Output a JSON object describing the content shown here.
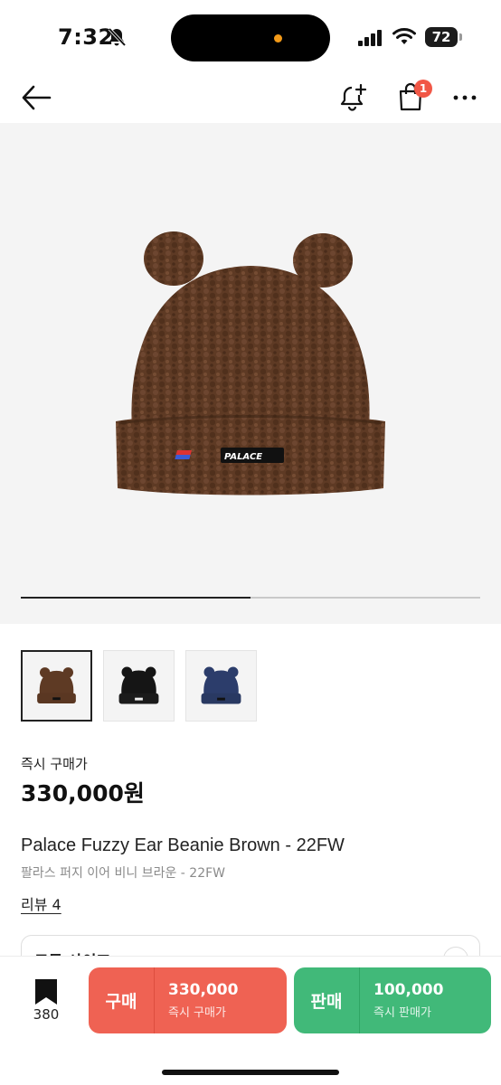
{
  "status_bar": {
    "time": "7:32",
    "battery": "72"
  },
  "nav": {
    "bag_badge": "1"
  },
  "gallery": {
    "brand_patch_text": "PALACE",
    "current_image_fraction": 0.5,
    "thumbnail_colors": [
      "brown",
      "black",
      "navy"
    ]
  },
  "product": {
    "price_label": "즉시 구매가",
    "price": "330,000원",
    "name_en": "Palace Fuzzy Ear Beanie Brown - 22FW",
    "name_ko": "팔라스 퍼지 이어 비니 브라운 - 22FW",
    "review_link": "리뷰 4",
    "size_label": "모든 사이즈"
  },
  "bottom_bar": {
    "wish_count": "380",
    "buy": {
      "tag": "구매",
      "price": "330,000",
      "sub": "즉시 구매가"
    },
    "sell": {
      "tag": "판매",
      "price": "100,000",
      "sub": "즉시 판매가"
    }
  },
  "colors": {
    "buy": "#ef6253",
    "sell": "#41b979",
    "badge": "#f15746",
    "beanie_brown": "#5e3a24"
  },
  "icons": [
    "bell-slash-icon",
    "signal-icon",
    "wifi-icon",
    "back-arrow-icon",
    "bell-plus-icon",
    "shopping-bag-icon",
    "more-icon",
    "bookmark-icon",
    "chevron-down-icon"
  ]
}
